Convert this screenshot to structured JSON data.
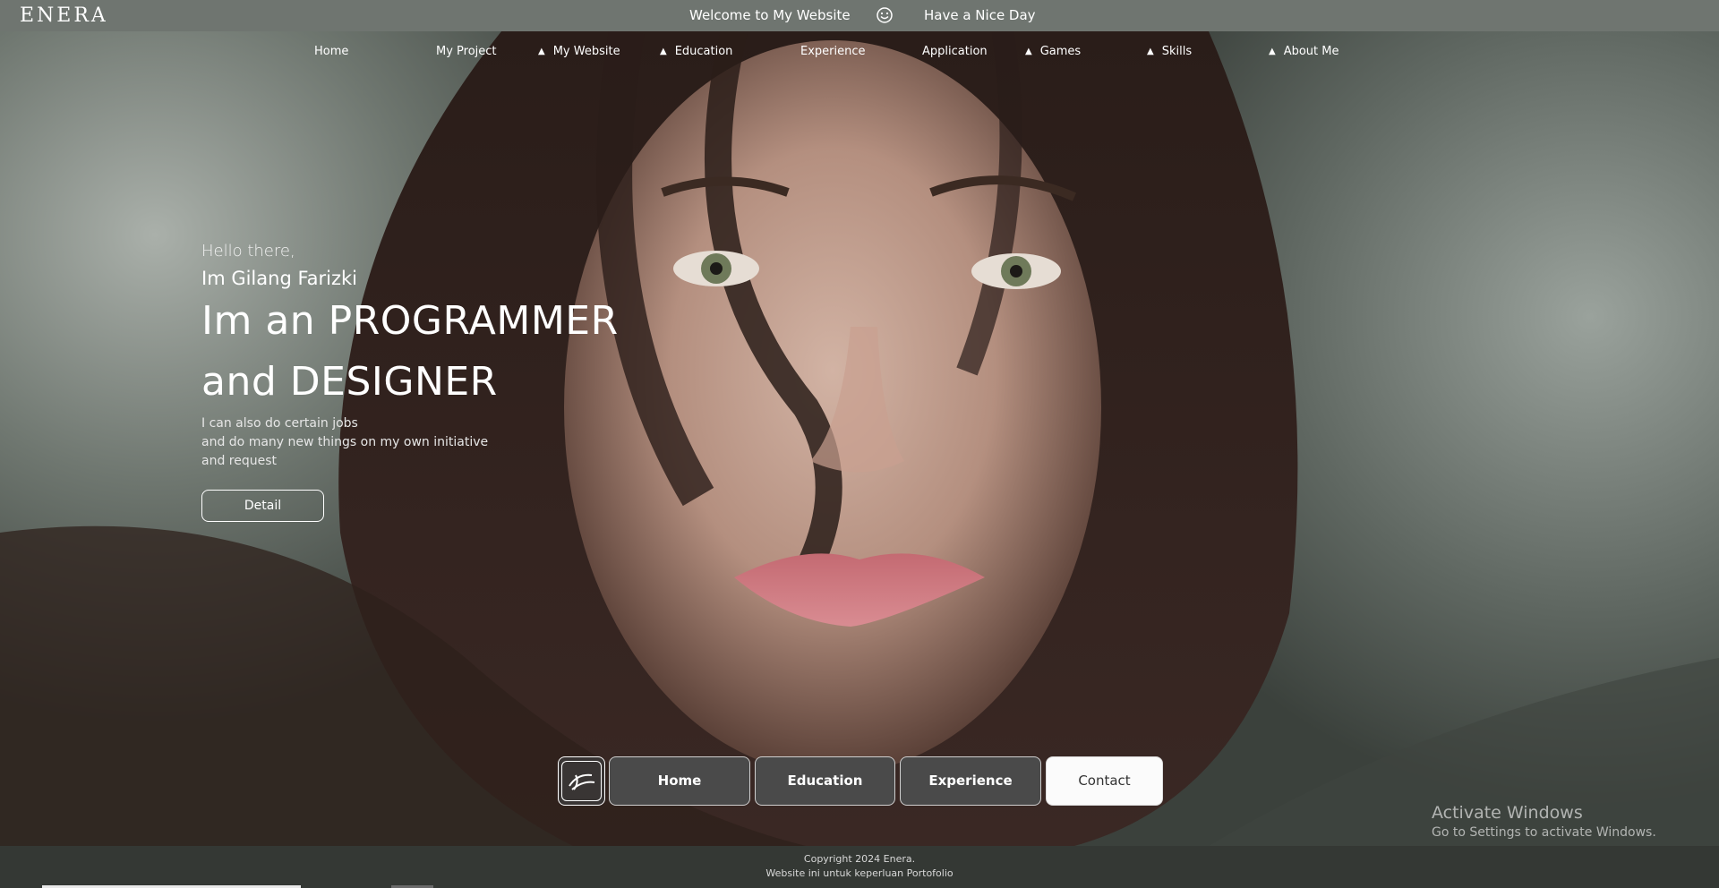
{
  "header": {
    "logo_text": "ENERA",
    "welcome_text": "Welcome to My Website",
    "smile_icon": "smile-icon",
    "greeting_text": "Have a Nice Day"
  },
  "nav": {
    "items": [
      {
        "label": "Home",
        "has_triangle": false
      },
      {
        "label": "My Project",
        "has_triangle": false
      },
      {
        "label": "My Website",
        "has_triangle": true
      },
      {
        "label": "Education",
        "has_triangle": true
      },
      {
        "label": "Experience",
        "has_triangle": false
      },
      {
        "label": "Application",
        "has_triangle": false
      },
      {
        "label": "Games",
        "has_triangle": true
      },
      {
        "label": "Skills",
        "has_triangle": true
      },
      {
        "label": "About Me",
        "has_triangle": true
      }
    ],
    "triangle_glyph": "▲"
  },
  "hero": {
    "hello": "Hello there,",
    "name": "Im Gilang Farizki",
    "headline_line1": "Im an PROGRAMMER",
    "headline_line2": "and DESIGNER",
    "desc_line1": "I can also do certain jobs",
    "desc_line2": "and do many new things on my own initiative",
    "desc_line3": "and request",
    "detail_button": "Detail"
  },
  "dock": {
    "logo_icon": "enera-logo-icon",
    "buttons": [
      {
        "label": "Home",
        "active": false
      },
      {
        "label": "Education",
        "active": false
      },
      {
        "label": "Experience",
        "active": false
      },
      {
        "label": "Contact",
        "active": true
      }
    ]
  },
  "watermark": {
    "line1": "Activate Windows",
    "line2": "Go to Settings to activate Windows."
  },
  "footer": {
    "copyright": "Copyright 2024 Enera.",
    "note": "Website ini untuk keperluan Portofolio"
  },
  "colors": {
    "topbar": "#6f7570",
    "footer": "#343834",
    "dock_button": "#4a4a4a",
    "dock_active": "#fbfbfb"
  }
}
